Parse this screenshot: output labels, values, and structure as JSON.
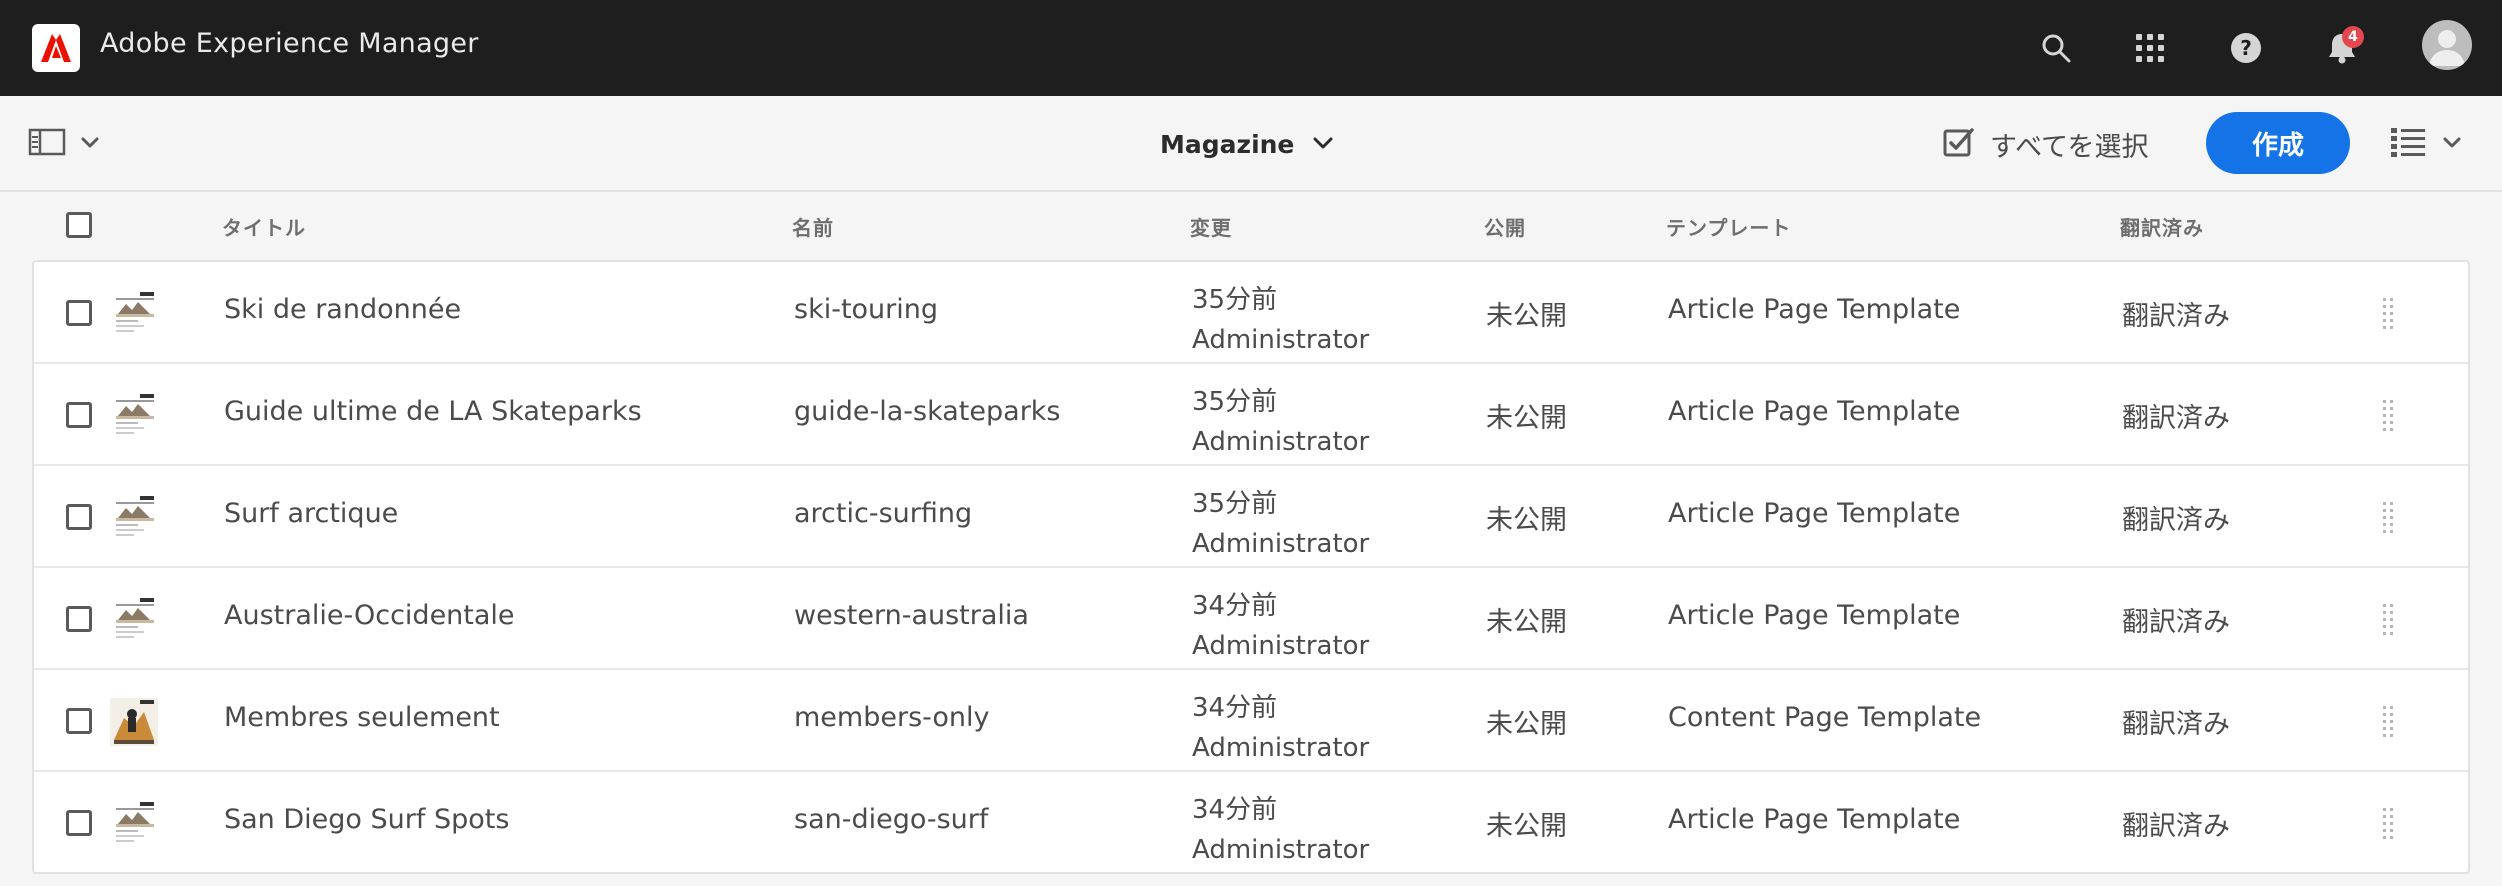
{
  "shell": {
    "app_title": "Adobe Experience Manager",
    "notification_count": "4",
    "icons": [
      "adobe-logo",
      "search-icon",
      "apps-grid-icon",
      "help-icon",
      "bell-icon",
      "user-avatar"
    ]
  },
  "actionbar": {
    "breadcrumb_title": "Magazine",
    "select_all_label": "すべてを選択",
    "create_label": "作成"
  },
  "table": {
    "columns": {
      "title": "タイトル",
      "name": "名前",
      "modified": "変更",
      "published": "公開",
      "template": "テンプレート",
      "translated": "翻訳済み"
    },
    "rows": [
      {
        "title": "Ski de randonnée",
        "name": "ski-touring",
        "modified_time": "35分前",
        "modified_by": "Administrator",
        "published": "未公開",
        "template": "Article Page Template",
        "translated": "翻訳済み"
      },
      {
        "title": "Guide ultime de LA Skateparks",
        "name": "guide-la-skateparks",
        "modified_time": "35分前",
        "modified_by": "Administrator",
        "published": "未公開",
        "template": "Article Page Template",
        "translated": "翻訳済み"
      },
      {
        "title": "Surf arctique",
        "name": "arctic-surfing",
        "modified_time": "35分前",
        "modified_by": "Administrator",
        "published": "未公開",
        "template": "Article Page Template",
        "translated": "翻訳済み"
      },
      {
        "title": "Australie-Occidentale",
        "name": "western-australia",
        "modified_time": "34分前",
        "modified_by": "Administrator",
        "published": "未公開",
        "template": "Article Page Template",
        "translated": "翻訳済み"
      },
      {
        "title": "Membres seulement",
        "name": "members-only",
        "modified_time": "34分前",
        "modified_by": "Administrator",
        "published": "未公開",
        "template": "Content Page Template",
        "translated": "翻訳済み"
      },
      {
        "title": "San Diego Surf Spots",
        "name": "san-diego-surf",
        "modified_time": "34分前",
        "modified_by": "Administrator",
        "published": "未公開",
        "template": "Article Page Template",
        "translated": "翻訳済み"
      }
    ]
  },
  "colors": {
    "shell_bg": "#1e1e1e",
    "accent": "#1473e6",
    "brand_red": "#eb1000",
    "badge": "#e34850"
  }
}
